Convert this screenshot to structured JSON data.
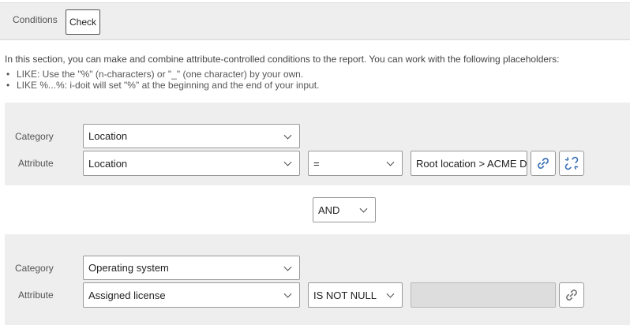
{
  "header": {
    "tab_label": "Conditions",
    "check_button": "Check"
  },
  "intro": {
    "text": "In this section, you can make and combine attribute-controlled conditions to the report. You can work with the following placeholders:",
    "hints": [
      "LIKE: Use the \"%\" (n-characters) or \"_\" (one character) by your own.",
      "LIKE %...%: i-doit will set \"%\" at the beginning and the end of your input."
    ]
  },
  "labels": {
    "category": "Category",
    "attribute": "Attribute"
  },
  "condition_1": {
    "category": "Location",
    "attribute": "Location",
    "operator": "=",
    "value": "Root location > ACME Data Center"
  },
  "connector": {
    "value": "AND"
  },
  "condition_2": {
    "category": "Operating system",
    "attribute": "Assigned license",
    "operator": "IS NOT NULL",
    "value": ""
  },
  "icons": {
    "link": "link-icon",
    "unlink": "unlink-icon"
  },
  "colors": {
    "icon_blue": "#3a6fb5",
    "panel_gray": "#eeeeee",
    "disabled_field": "#dddddd"
  }
}
